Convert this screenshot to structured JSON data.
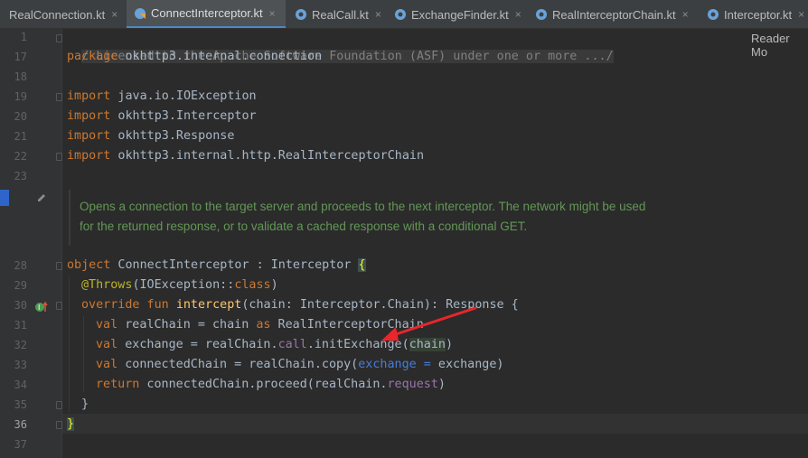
{
  "tabs": [
    {
      "label": "RealConnection.kt",
      "close": "×"
    },
    {
      "label": "ConnectInterceptor.kt",
      "close": "×",
      "active": true
    },
    {
      "label": "RealCall.kt",
      "close": "×"
    },
    {
      "label": "ExchangeFinder.kt",
      "close": "×"
    },
    {
      "label": "RealInterceptorChain.kt",
      "close": "×"
    },
    {
      "label": "Interceptor.kt",
      "close": "×"
    }
  ],
  "reader_mode": "Reader Mo",
  "line_numbers": {
    "l1": "1",
    "l17": "17",
    "l18": "18",
    "l19": "19",
    "l20": "20",
    "l21": "21",
    "l22": "22",
    "l23": "23",
    "l28": "28",
    "l29": "29",
    "l30": "30",
    "l31": "31",
    "l32": "32",
    "l33": "33",
    "l34": "34",
    "l35": "35",
    "l36": "36",
    "l37": "37"
  },
  "code": {
    "license": "/ Licensed to the Apache Software Foundation (ASF) under one or more .../",
    "package_kw": "package",
    "package_name": " okhttp3.internal.connection",
    "import_kw": "import",
    "import1": " java.io.IOException",
    "import2": " okhttp3.Interceptor",
    "import3": " okhttp3.Response",
    "import4": " okhttp3.internal.http.RealInterceptorChain",
    "object_kw": "object",
    "object_rest": " ConnectInterceptor : Interceptor ",
    "open_brace": "{",
    "annotation": "@Throws",
    "ann_open": "(IOException::",
    "class_kw": "class",
    "ann_close": ")",
    "override_kw": "override fun ",
    "fn_name": "intercept",
    "fn_sig": "(chain: Interceptor.Chain): Response {",
    "val_kw": "val",
    "l31_rest": " realChain = chain ",
    "as_kw": "as",
    "l31_type": " RealInterceptorChain",
    "l32_a": " exchange = realChain.",
    "l32_call": "call",
    "l32_b": ".initExchange(",
    "l32_chain": "chain",
    "l32_c": ")",
    "l33_a": " connectedChain = realChain.copy(",
    "l33_param": "exchange = ",
    "l33_b": "exchange)",
    "return_kw": "return",
    "l34_a": " connectedChain.proceed(realChain.",
    "l34_prop": "request",
    "l34_b": ")",
    "close_inner": "}",
    "close_outer": "}"
  },
  "doc_comment": "Opens a connection to the target server and proceeds to the next interceptor. The network might be used for the returned response, or to validate a cached response with a conditional GET.",
  "colors": {
    "keyword": "#cc7832",
    "doc": "#629755",
    "arrow": "#e8262b",
    "tab_accent": "#4a88c7"
  },
  "icons": {
    "kotlin_file": "kotlin-file-icon",
    "edit_doc": "pencil-icon",
    "override": "override-gutter-icon"
  }
}
